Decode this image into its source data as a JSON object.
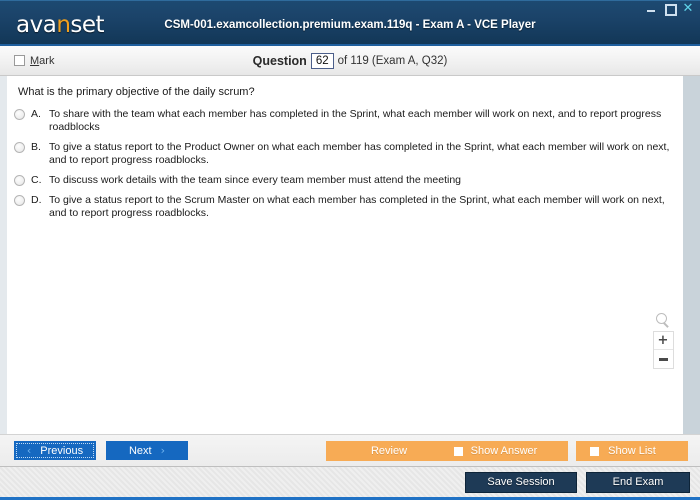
{
  "window": {
    "logo_text_before": "ava",
    "logo_text_highlight": "n",
    "logo_text_after": "set",
    "title": "CSM-001.examcollection.premium.exam.119q - Exam A - VCE Player",
    "controls": {
      "minimize": "minimize-icon",
      "maximize": "maximize-icon",
      "close": "✕"
    }
  },
  "toolbar": {
    "mark_label_first": "M",
    "mark_label_rest": "ark",
    "question_word": "Question",
    "question_number": "62",
    "question_rest": "of 119 (Exam A, Q32)"
  },
  "question": {
    "text": "What is the primary objective of the daily scrum?",
    "options": [
      {
        "letter": "A.",
        "text": "To share with the team what each member has completed in the Sprint, what each member will work on next, and to report progress roadblocks"
      },
      {
        "letter": "B.",
        "text": "To give a status report to the Product Owner on what each member has completed in the Sprint, what each member will work on next, and to report progress roadblocks."
      },
      {
        "letter": "C.",
        "text": "To discuss work details with the team since every team member must attend the meeting"
      },
      {
        "letter": "D.",
        "text": "To give a status report to the Scrum Master on what each member has completed in the Sprint, what each member will work on next, and to report progress roadblocks."
      }
    ]
  },
  "zoom_controls": {
    "magnifier": "magnifier-icon",
    "zoom_in": "+",
    "zoom_out": "−"
  },
  "navbar": {
    "previous": "Previous",
    "next": "Next",
    "review": "Review",
    "show_answer": "Show Answer",
    "show_list": "Show List",
    "chevron_left": "‹",
    "chevron_right": "›"
  },
  "statusbar": {
    "save_session": "Save Session",
    "end_exam": "End Exam"
  },
  "colors": {
    "titlebar_dark": "#123757",
    "accent_blue": "#1568c0",
    "orange": "#f7ab55",
    "logo_accent": "#f0a01e",
    "dark_button": "#1e3a56",
    "status_border": "#2072c5"
  }
}
